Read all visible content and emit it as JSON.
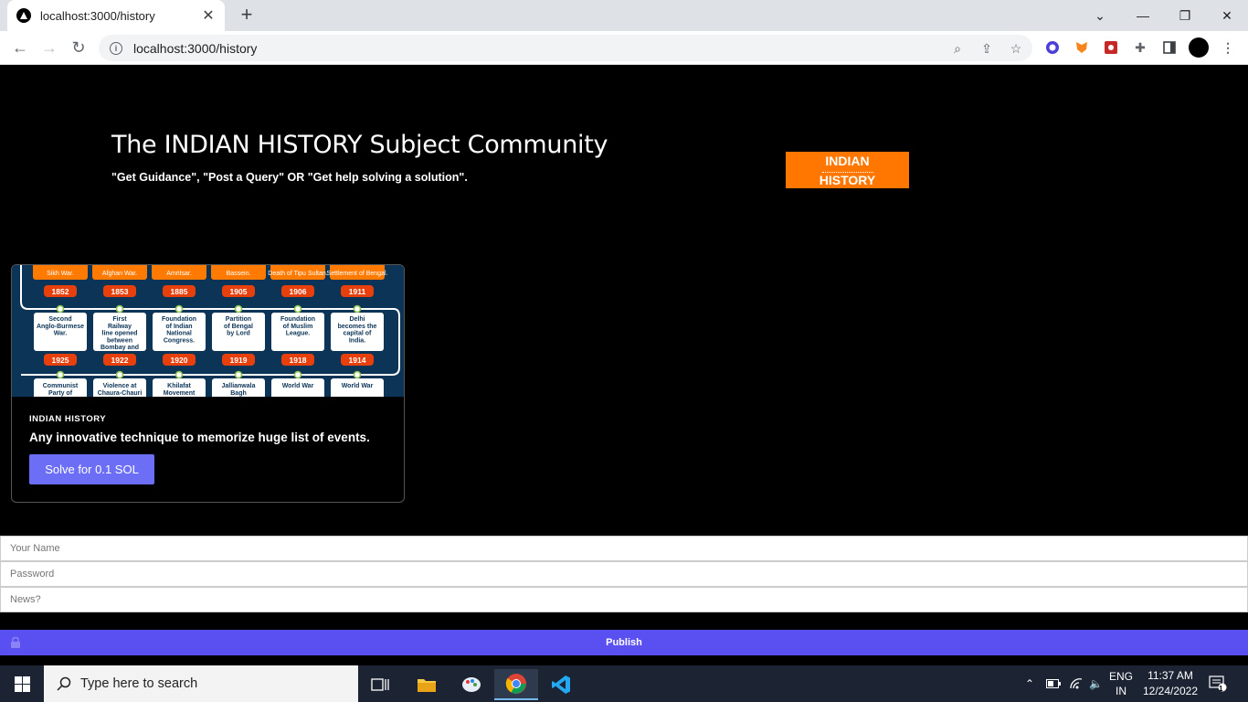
{
  "browser": {
    "tab_title": "localhost:3000/history",
    "url": "localhost:3000/history"
  },
  "hero": {
    "title": "The INDIAN HISTORY Subject Community",
    "subtitle": "\"Get Guidance\", \"Post a Query\" OR \"Get help solving a solution\".",
    "badge_line1": "INDIAN",
    "badge_line2": "HISTORY"
  },
  "card": {
    "tag": "INDIAN HISTORY",
    "title": "Any innovative technique to memorize huge list of events.",
    "button": "Solve for 0.1 SOL",
    "timeline_top": [
      "Sikh War.",
      "Afghan War.",
      "Amritsar.",
      "Bassein.",
      "Death of Tipu Sultan.",
      "Settlement of Bengal."
    ],
    "timeline_years_row1": [
      "1852",
      "1853",
      "1885",
      "1905",
      "1906",
      "1911"
    ],
    "timeline_events_row1": [
      "Second Anglo-Burmese War.",
      "First Railway line opened between Bombay and Thane",
      "Foundation of Indian National Congress.",
      "Partition of Bengal by Lord",
      "Foundation of Muslim League.",
      "Delhi becomes the capital of India."
    ],
    "timeline_years_row2": [
      "1925",
      "1922",
      "1920",
      "1919",
      "1918",
      "1914"
    ],
    "timeline_events_row2": [
      "Communist Party of India",
      "Violence at Chaura-Chauri",
      "Khilafat Movement",
      "Jallianwala Bagh",
      "World War",
      "World War"
    ]
  },
  "form": {
    "name_placeholder": "Your Name",
    "password_placeholder": "Password",
    "news_placeholder": "News?",
    "publish": "Publish"
  },
  "taskbar": {
    "search_placeholder": "Type here to search",
    "lang1": "ENG",
    "lang2": "IN",
    "time": "11:37 AM",
    "date": "12/24/2022",
    "notif_count": "1"
  }
}
